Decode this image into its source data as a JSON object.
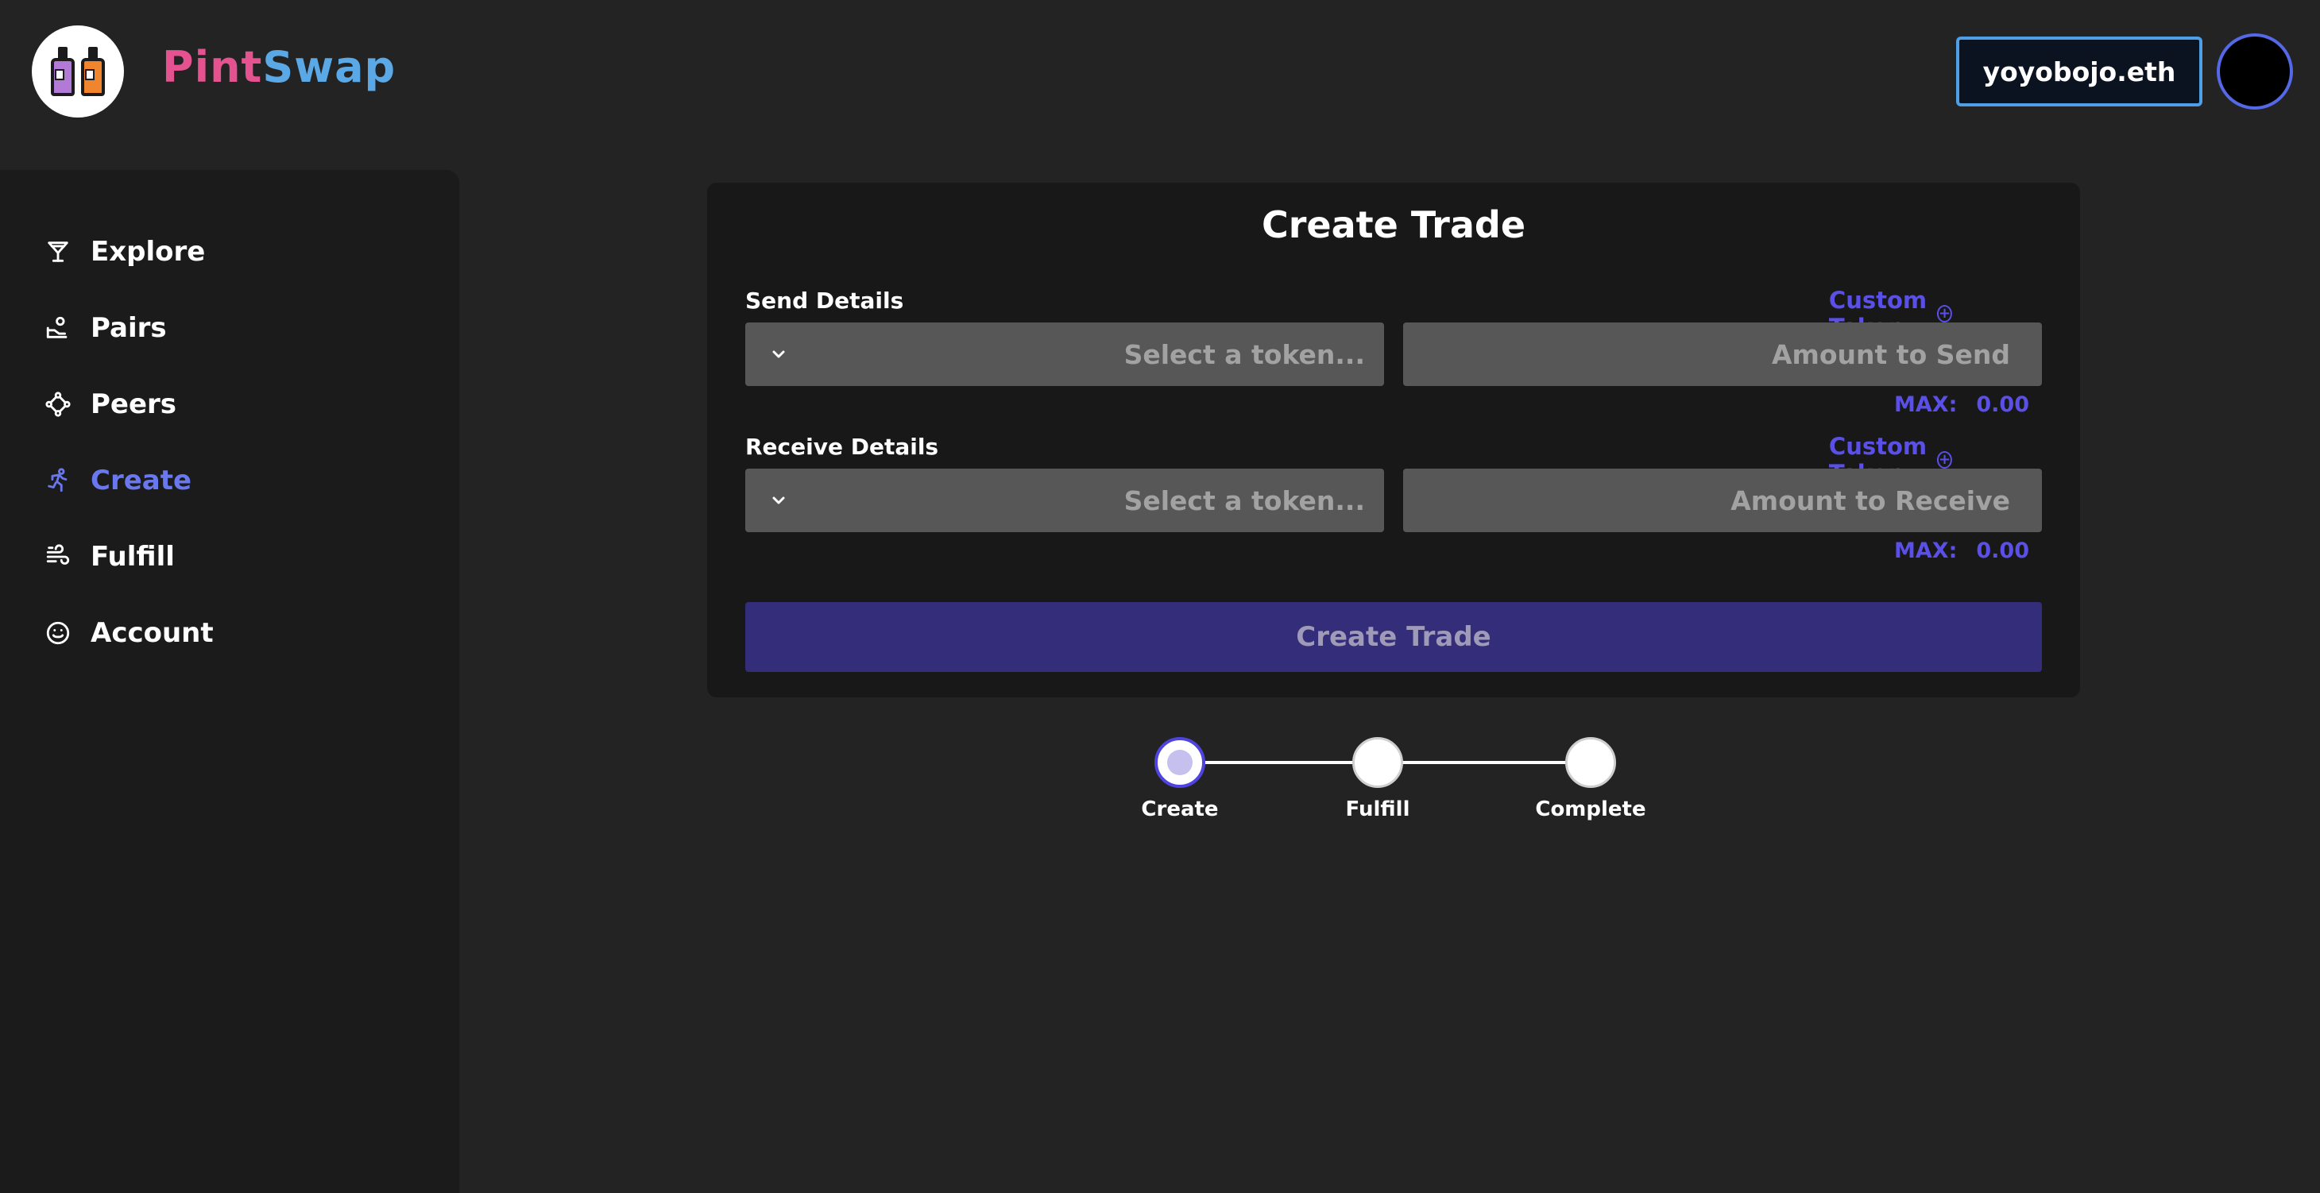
{
  "header": {
    "brand_part1": "Pint",
    "brand_part2": "Swap",
    "wallet_label": "yoyobojo.eth"
  },
  "sidebar": {
    "items": [
      {
        "label": "Explore",
        "icon": "cocktail-glass-icon"
      },
      {
        "label": "Pairs",
        "icon": "hand-coin-icon"
      },
      {
        "label": "Peers",
        "icon": "peers-network-icon"
      },
      {
        "label": "Create",
        "icon": "running-person-icon",
        "active": true
      },
      {
        "label": "Fulfill",
        "icon": "wind-icon"
      },
      {
        "label": "Account",
        "icon": "smiley-face-icon"
      }
    ]
  },
  "main": {
    "title": "Create Trade",
    "send": {
      "label": "Send Details",
      "custom_token": "Custom Token",
      "select_placeholder": "Select a token...",
      "amount_placeholder": "Amount to Send",
      "max_label": "MAX:",
      "max_value": "0.00"
    },
    "receive": {
      "label": "Receive Details",
      "custom_token": "Custom Token",
      "select_placeholder": "Select a token...",
      "amount_placeholder": "Amount to Receive",
      "max_label": "MAX:",
      "max_value": "0.00"
    },
    "submit_label": "Create Trade"
  },
  "stepper": {
    "steps": [
      "Create",
      "Fulfill",
      "Complete"
    ],
    "active_index": 0
  },
  "colors": {
    "background": "#232323",
    "sidebar": "#1b1b1b",
    "accent": "#5a4fe6",
    "active_nav": "#6a78f0",
    "brand_pink": "#e4528f",
    "brand_blue": "#5aa9e6",
    "button": "#332d7a"
  }
}
